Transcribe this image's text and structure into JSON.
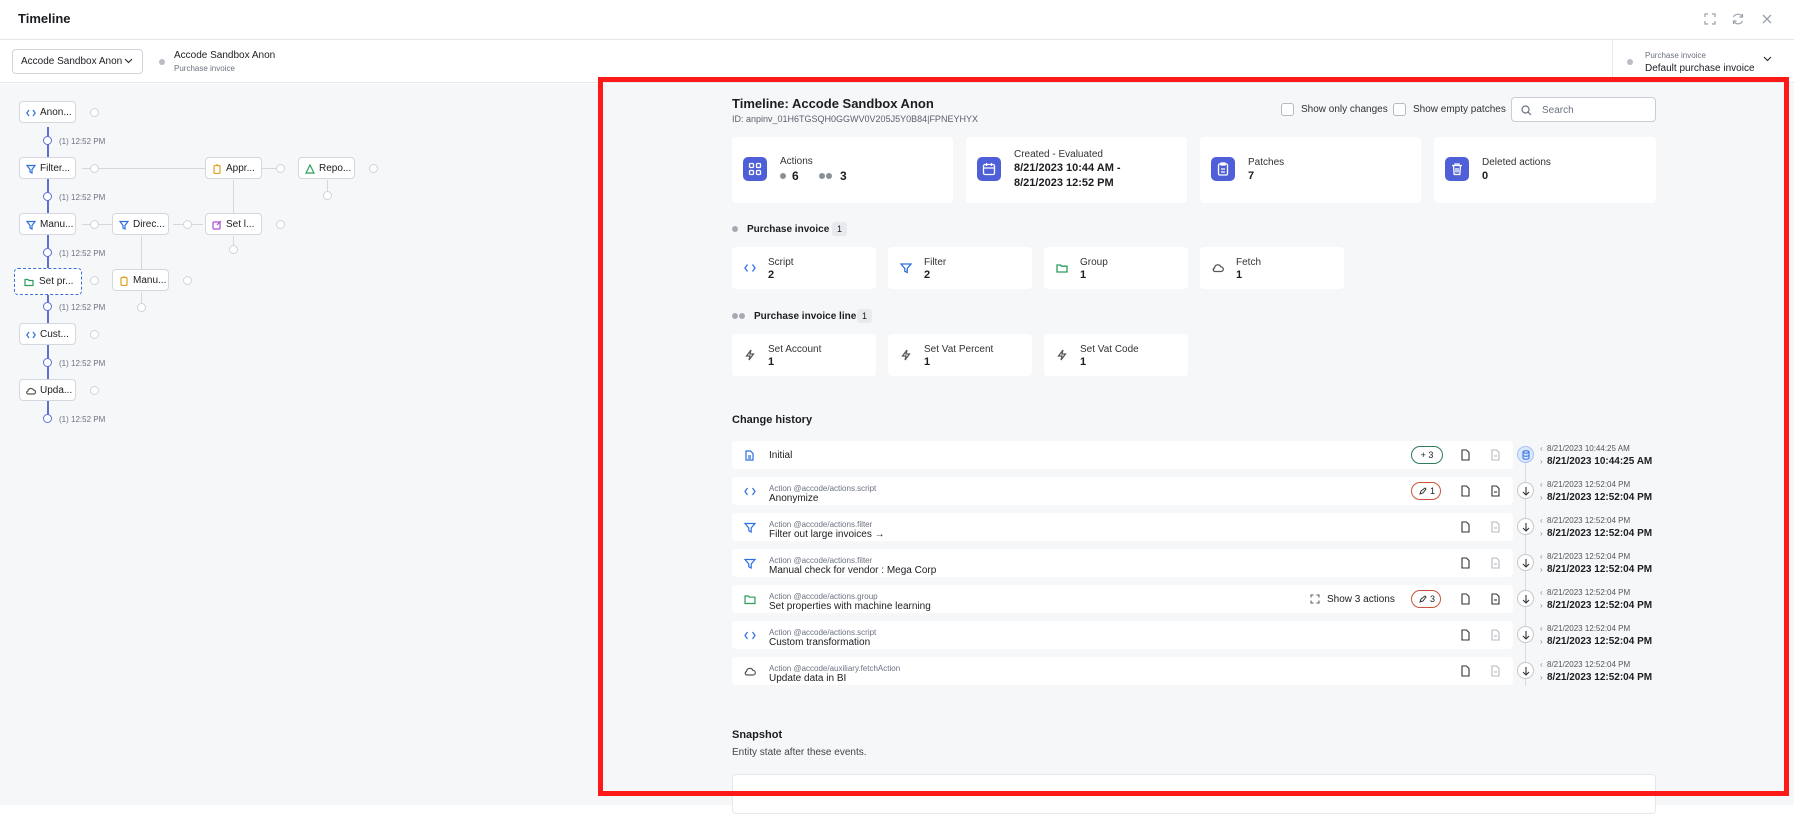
{
  "header": {
    "title": "Timeline"
  },
  "subbar": {
    "selector_value": "Accode Sandbox Anon",
    "entity_name": "Accode Sandbox Anon",
    "entity_type": "Purchase invoice",
    "right_label": "Purchase invoice",
    "right_value": "Default purchase invoice"
  },
  "graph": {
    "nodes": [
      {
        "label": "Anon...",
        "icon": "code-icon"
      },
      {
        "label": "Filter...",
        "icon": "filter-icon"
      },
      {
        "label": "Appr...",
        "icon": "clipboard-icon"
      },
      {
        "label": "Repo...",
        "icon": "warning-icon"
      },
      {
        "label": "Manu...",
        "icon": "filter-icon"
      },
      {
        "label": "Direc...",
        "icon": "filter-icon"
      },
      {
        "label": "Set l...",
        "icon": "edit-icon"
      },
      {
        "label": "Set pr...",
        "icon": "folder-icon"
      },
      {
        "label": "Manu...",
        "icon": "clipboard-icon"
      },
      {
        "label": "Cust...",
        "icon": "code-icon"
      },
      {
        "label": "Upda...",
        "icon": "cloud-icon"
      }
    ],
    "times": [
      "(1) 12:52 PM",
      "(1) 12:52 PM",
      "(1) 12:52 PM",
      "(1) 12:52 PM",
      "(1) 12:52 PM",
      "(1) 12:52 PM"
    ]
  },
  "timeline": {
    "title": "Timeline: Accode Sandbox Anon",
    "id": "ID: anpinv_01H6TGSQH0GGWV0V205J5Y0B84|FPNEYHYX",
    "show_only_changes": "Show only changes",
    "show_empty_patches": "Show empty patches",
    "search_placeholder": "Search"
  },
  "stats": {
    "actions_label": "Actions",
    "actions_a": "6",
    "actions_b": "3",
    "created_label": "Created - Evaluated",
    "created_line1": "8/21/2023 10:44 AM -",
    "created_line2": "8/21/2023 12:52 PM",
    "patches_label": "Patches",
    "patches_value": "7",
    "deleted_label": "Deleted actions",
    "deleted_value": "0"
  },
  "sections": [
    {
      "label": "Purchase invoice",
      "count": "1",
      "cards": [
        {
          "label": "Script",
          "value": "2",
          "icon": "code-icon"
        },
        {
          "label": "Filter",
          "value": "2",
          "icon": "filter-icon"
        },
        {
          "label": "Group",
          "value": "1",
          "icon": "folder-icon"
        },
        {
          "label": "Fetch",
          "value": "1",
          "icon": "cloud-icon"
        }
      ]
    },
    {
      "label": "Purchase invoice line",
      "count": "1",
      "cards": [
        {
          "label": "Set Account",
          "value": "1",
          "icon": "bolt-icon"
        },
        {
          "label": "Set Vat Percent",
          "value": "1",
          "icon": "bolt-icon"
        },
        {
          "label": "Set Vat Code",
          "value": "1",
          "icon": "bolt-icon"
        }
      ]
    }
  ],
  "history": {
    "title": "Change history",
    "rows": [
      {
        "kind": "",
        "title": "Initial",
        "pill": "+ 3",
        "ts1": "8/21/2023 10:44:25 AM",
        "ts2": "8/21/2023 10:44:25 AM"
      },
      {
        "kind": "Action @accode/actions.script",
        "title": "Anonymize",
        "pill": "1",
        "ts1": "8/21/2023 12:52:04 PM",
        "ts2": "8/21/2023 12:52:04 PM"
      },
      {
        "kind": "Action @accode/actions.filter",
        "title": "Filter out large invoices →",
        "pill": "",
        "ts1": "8/21/2023 12:52:04 PM",
        "ts2": "8/21/2023 12:52:04 PM"
      },
      {
        "kind": "Action @accode/actions.filter",
        "title": "Manual check for vendor : Mega Corp",
        "pill": "",
        "ts1": "8/21/2023 12:52:04 PM",
        "ts2": "8/21/2023 12:52:04 PM"
      },
      {
        "kind": "Action @accode/actions.group",
        "title": "Set properties with machine learning",
        "pill": "3",
        "show_actions": "Show 3 actions",
        "ts1": "8/21/2023 12:52:04 PM",
        "ts2": "8/21/2023 12:52:04 PM"
      },
      {
        "kind": "Action @accode/actions.script",
        "title": "Custom transformation",
        "pill": "",
        "ts1": "8/21/2023 12:52:04 PM",
        "ts2": "8/21/2023 12:52:04 PM"
      },
      {
        "kind": "Action @accode/auxiliary.fetchAction",
        "title": "Update data in BI",
        "pill": "",
        "ts1": "8/21/2023 12:52:04 PM",
        "ts2": "8/21/2023 12:52:04 PM"
      }
    ]
  },
  "snapshot": {
    "title": "Snapshot",
    "subtitle": "Entity state after these events."
  },
  "colors": {
    "accent": "#4f5fd8",
    "highlight": "#ff1a1a",
    "blue_icon": "#2f6fe0",
    "green_icon": "#2a9d5c",
    "pill_green": "#2f7d5a",
    "pill_orange": "#c7553b"
  }
}
